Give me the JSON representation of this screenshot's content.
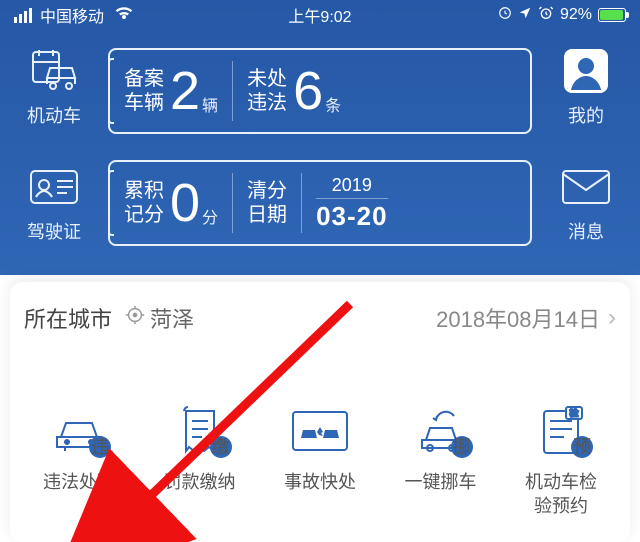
{
  "status": {
    "carrier": "中国移动",
    "time": "上午9:02",
    "battery_pct": "92%"
  },
  "side_left": [
    {
      "label": "机动车"
    },
    {
      "label": "驾驶证"
    }
  ],
  "side_right": [
    {
      "label": "我的"
    },
    {
      "label": "消息"
    }
  ],
  "box1": {
    "lab1a": "备案",
    "lab1b": "车辆",
    "val1": "2",
    "unit1": "辆",
    "lab2a": "未处",
    "lab2b": "违法",
    "val2": "6",
    "unit2": "条"
  },
  "box2": {
    "lab1a": "累积",
    "lab1b": "记分",
    "val1": "0",
    "unit1": "分",
    "lab2a": "清分",
    "lab2b": "日期",
    "year": "2019",
    "md": "03-20"
  },
  "city": {
    "label": "所在城市",
    "name": "菏泽",
    "date": "2018年08月14日"
  },
  "icons": [
    {
      "label": "违法处理",
      "badge": "违"
    },
    {
      "label": "罚款缴纳",
      "badge": "缴"
    },
    {
      "label": "事故快处",
      "badge": ""
    },
    {
      "label": "一键挪车",
      "badge": "挪"
    },
    {
      "label": "机动车检\n验预约",
      "badge": "预"
    }
  ]
}
